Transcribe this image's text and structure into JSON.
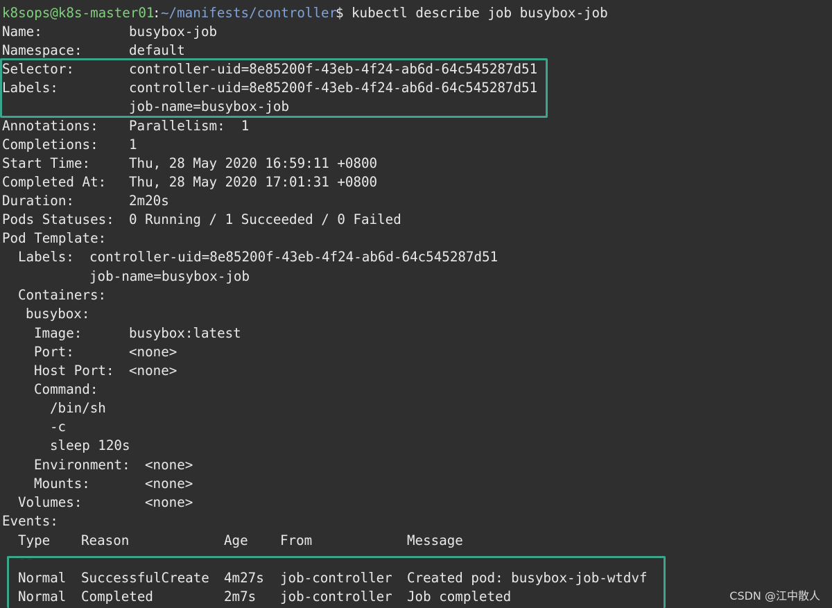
{
  "prompt": {
    "user_host": "k8sops@k8s-master01",
    "separator": ":",
    "path": "~/manifests/controller",
    "symbol": "$",
    "command": "kubectl describe job busybox-job"
  },
  "fields": {
    "name": {
      "key": "Name:",
      "value": "busybox-job"
    },
    "namespace": {
      "key": "Namespace:",
      "value": "default"
    },
    "selector": {
      "key": "Selector:",
      "value": "controller-uid=8e85200f-43eb-4f24-ab6d-64c545287d51"
    },
    "labels": {
      "key": "Labels:",
      "value": "controller-uid=8e85200f-43eb-4f24-ab6d-64c545287d51",
      "value2": "job-name=busybox-job"
    },
    "annotations": {
      "key": "Annotations:",
      "value": "Parallelism:  1"
    },
    "completions": {
      "key": "Completions:",
      "value": "1"
    },
    "start_time": {
      "key": "Start Time:",
      "value": "Thu, 28 May 2020 16:59:11 +0800"
    },
    "completed_at": {
      "key": "Completed At:",
      "value": "Thu, 28 May 2020 17:01:31 +0800"
    },
    "duration": {
      "key": "Duration:",
      "value": "2m20s"
    },
    "pods_statuses": {
      "key": "Pods Statuses:",
      "value": "0 Running / 1 Succeeded / 0 Failed"
    }
  },
  "pod_template": {
    "heading": "Pod Template:",
    "labels_key": "Labels:",
    "labels_value": "controller-uid=8e85200f-43eb-4f24-ab6d-64c545287d51",
    "labels_value2": "job-name=busybox-job",
    "containers_key": "Containers:",
    "container_name": "busybox:",
    "image_key": "Image:",
    "image_value": "busybox:latest",
    "port_key": "Port:",
    "port_value": "<none>",
    "host_port_key": "Host Port:",
    "host_port_value": "<none>",
    "command_key": "Command:",
    "command_lines": [
      "/bin/sh",
      "-c",
      "sleep 120s"
    ],
    "environment_key": "Environment:",
    "environment_value": "<none>",
    "mounts_key": "Mounts:",
    "mounts_value": "<none>",
    "volumes_key": "Volumes:",
    "volumes_value": "<none>"
  },
  "events": {
    "heading": "Events:",
    "columns": [
      "Type",
      "Reason",
      "Age",
      "From",
      "Message"
    ],
    "dashes": [
      "----",
      "------",
      "----",
      "----",
      "-------"
    ],
    "rows": [
      [
        "Normal",
        "SuccessfulCreate",
        "4m27s",
        "job-controller",
        "Created pod: busybox-job-wtdvf"
      ],
      [
        "Normal",
        "Completed",
        "2m7s",
        "job-controller",
        "Job completed"
      ]
    ]
  },
  "watermark": "CSDN @江中散人",
  "colors": {
    "background": "#2f2f2f",
    "text": "#e9e9e9",
    "prompt_user": "#7fd07c",
    "prompt_path": "#7fa2d8",
    "highlight_border": "#3aa68c"
  }
}
